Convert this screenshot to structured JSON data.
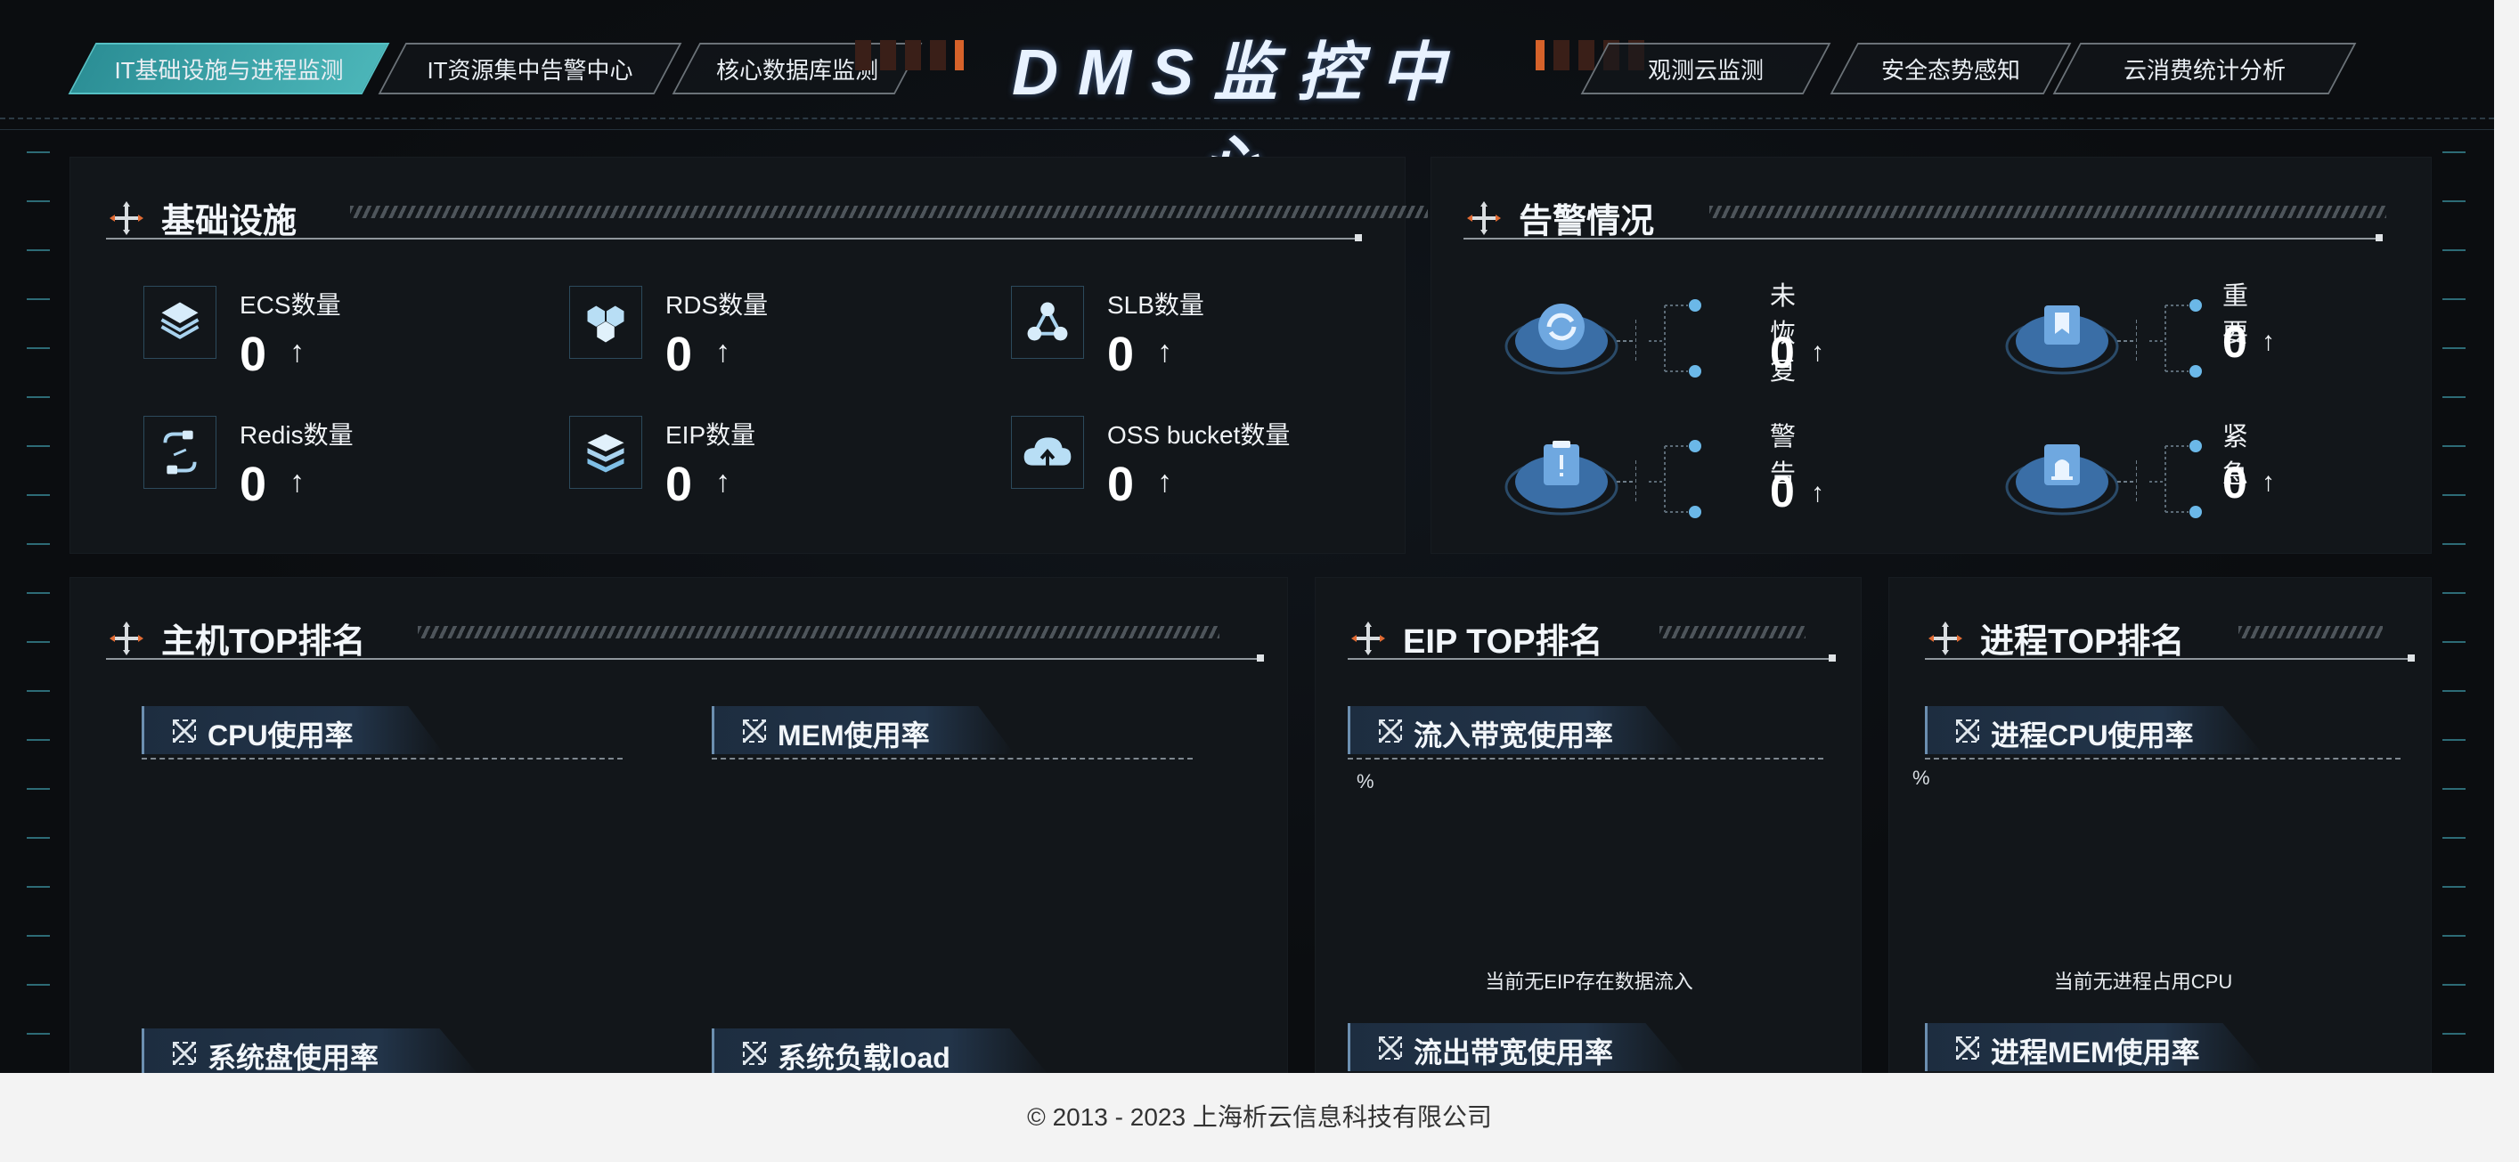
{
  "app": {
    "title": "DMS监控中心"
  },
  "nav": {
    "left": [
      "IT基础设施与进程监测",
      "IT资源集中告警中心",
      "核心数据库监测"
    ],
    "right": [
      "观测云监测",
      "安全态势感知",
      "云消费统计分析"
    ],
    "active_index": 0
  },
  "infra": {
    "title": "基础设施",
    "items": [
      {
        "label": "ECS数量",
        "value": "0",
        "icon": "layers-icon"
      },
      {
        "label": "RDS数量",
        "value": "0",
        "icon": "database-cluster-icon"
      },
      {
        "label": "SLB数量",
        "value": "0",
        "icon": "network-nodes-icon"
      },
      {
        "label": "Redis数量",
        "value": "0",
        "icon": "plug-icon"
      },
      {
        "label": "EIP数量",
        "value": "0",
        "icon": "server-stack-icon"
      },
      {
        "label": "OSS bucket数量",
        "value": "0",
        "icon": "cloud-upload-icon"
      }
    ],
    "trend_symbol": "↑"
  },
  "alarms": {
    "title": "告警情况",
    "items": [
      {
        "label": "未恢复",
        "value": "0",
        "icon": "refresh-icon"
      },
      {
        "label": "重要",
        "value": "0",
        "icon": "bookmark-icon"
      },
      {
        "label": "警告",
        "value": "0",
        "icon": "clipboard-alert-icon"
      },
      {
        "label": "紧急",
        "value": "0",
        "icon": "siren-icon"
      }
    ],
    "trend_symbol": "↑"
  },
  "host_top": {
    "title": "主机TOP排名",
    "subs": [
      "CPU使用率",
      "MEM使用率",
      "系统盘使用率",
      "系统负载load"
    ]
  },
  "eip_top": {
    "title": "EIP TOP排名",
    "subs": [
      "流入带宽使用率",
      "流出带宽使用率"
    ],
    "unit": "%",
    "empty_text": "当前无EIP存在数据流入"
  },
  "process_top": {
    "title": "进程TOP排名",
    "subs": [
      "进程CPU使用率",
      "进程MEM使用率"
    ],
    "unit": "%",
    "empty_text": "当前无进程占用CPU"
  },
  "footer": {
    "copyright": "© 2013 - 2023 上海析云信息科技有限公司"
  },
  "colors": {
    "active_tab": "#3aa7ad",
    "accent_orange": "#d6622a",
    "panel_bg": "#12161a"
  }
}
